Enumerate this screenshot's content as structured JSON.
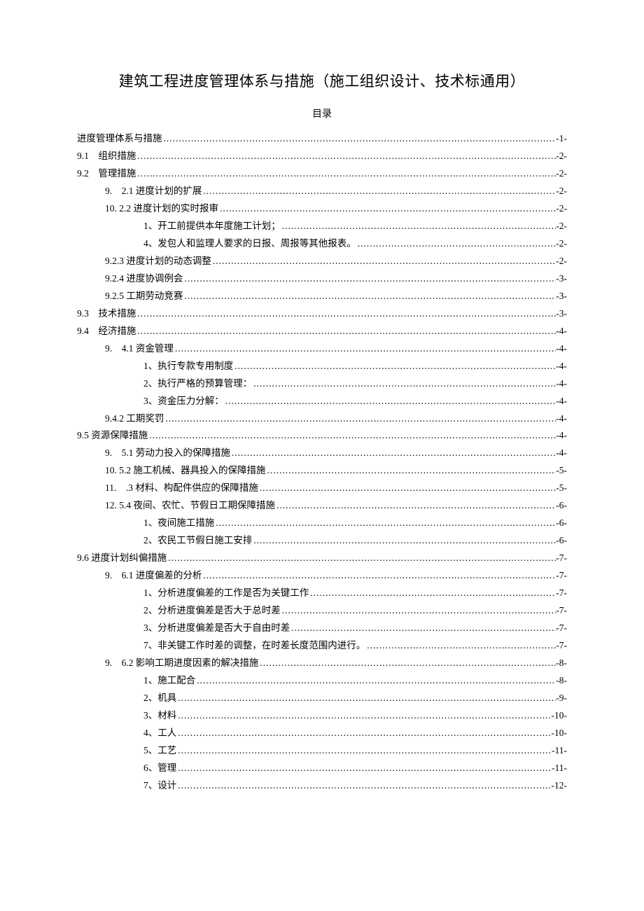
{
  "title": "建筑工程进度管理体系与措施（施工组织设计、技术标通用）",
  "toc_label": "目录",
  "toc": [
    {
      "indent": 0,
      "text": "进度管理体系与措施",
      "page": "-1-"
    },
    {
      "indent": 0,
      "text": "9.1　组织措施",
      "page": "-2-"
    },
    {
      "indent": 0,
      "text": "9.2　管理措施",
      "page": "-2-"
    },
    {
      "indent": 1,
      "text": "9.　2.1 进度计划的扩展",
      "page": "-2-"
    },
    {
      "indent": 1,
      "text": "10. 2.2 进度计划的实时报审",
      "page": "-2-"
    },
    {
      "indent": 2,
      "text": "1、开工前提供本年度施工计划；",
      "page": "-2-"
    },
    {
      "indent": 2,
      "text": "4、发包人和监理人要求的日报、周报等其他报表。",
      "page": "-2-"
    },
    {
      "indent": 1,
      "text": "9.2.3 进度计划的动态调整",
      "page": "-2-"
    },
    {
      "indent": 1,
      "text": "9.2.4 进度协调例会",
      "page": "-3-"
    },
    {
      "indent": 1,
      "text": "9.2.5 工期劳动竞赛",
      "page": "-3-"
    },
    {
      "indent": 0,
      "text": "9.3　技术措施",
      "page": "-3-"
    },
    {
      "indent": 0,
      "text": "9.4　经济措施",
      "page": "-4-"
    },
    {
      "indent": 1,
      "text": "9.　4.1 资金管理",
      "page": "-4-"
    },
    {
      "indent": 2,
      "text": "1、执行专款专用制度",
      "page": "-4-"
    },
    {
      "indent": 2,
      "text": "2、执行严格的预算管理：",
      "page": "-4-"
    },
    {
      "indent": 2,
      "text": "3、资金压力分解：",
      "page": "-4-"
    },
    {
      "indent": 1,
      "text": "9.4.2 工期奖罚",
      "page": "-4-"
    },
    {
      "indent": 0,
      "text": "9.5 资源保障措施",
      "page": "-4-"
    },
    {
      "indent": 1,
      "text": "9.　5.1 劳动力投入的保障措施",
      "page": "-4-"
    },
    {
      "indent": 1,
      "text": "10. 5.2 施工机械、器具投入的保障措施",
      "page": "-5-"
    },
    {
      "indent": 1,
      "text": "11.　.3 材料、构配件供应的保障措施",
      "page": "-5-"
    },
    {
      "indent": 1,
      "text": "12. 5.4 夜间、农忙、节假日工期保障措施",
      "page": "-6-"
    },
    {
      "indent": 2,
      "text": "1、夜间施工措施",
      "page": "-6-"
    },
    {
      "indent": 2,
      "text": "2、农民工节假日施工安排",
      "page": "-6-"
    },
    {
      "indent": 0,
      "text": "9.6 进度计划纠偏措施",
      "page": "-7-"
    },
    {
      "indent": 1,
      "text": "9.　6.1 进度偏差的分析",
      "page": "-7-"
    },
    {
      "indent": 2,
      "text": "1、分析进度偏差的工作是否为关键工作",
      "page": "-7-"
    },
    {
      "indent": 2,
      "text": "2、分析进度偏差是否大于总时差",
      "page": "-7-"
    },
    {
      "indent": 2,
      "text": "3、分析进度偏差是否大于自由时差",
      "page": "-7-"
    },
    {
      "indent": 2,
      "text": "7、非关键工作时差的调整，在时差长度范围内进行。",
      "page": "-7-"
    },
    {
      "indent": 1,
      "text": "9.　6.2 影响工期进度因素的解决措施",
      "page": "-8-"
    },
    {
      "indent": 2,
      "text": "1、施工配合",
      "page": "-8-"
    },
    {
      "indent": 2,
      "text": "2、机具",
      "page": "-9-"
    },
    {
      "indent": 2,
      "text": "3、材料",
      "page": "-10-"
    },
    {
      "indent": 2,
      "text": "4、工人",
      "page": "-10-"
    },
    {
      "indent": 2,
      "text": "5、工艺",
      "page": "-11-"
    },
    {
      "indent": 2,
      "text": "6、管理",
      "page": "-11-"
    },
    {
      "indent": 2,
      "text": "7、设计",
      "page": "-12-"
    }
  ]
}
